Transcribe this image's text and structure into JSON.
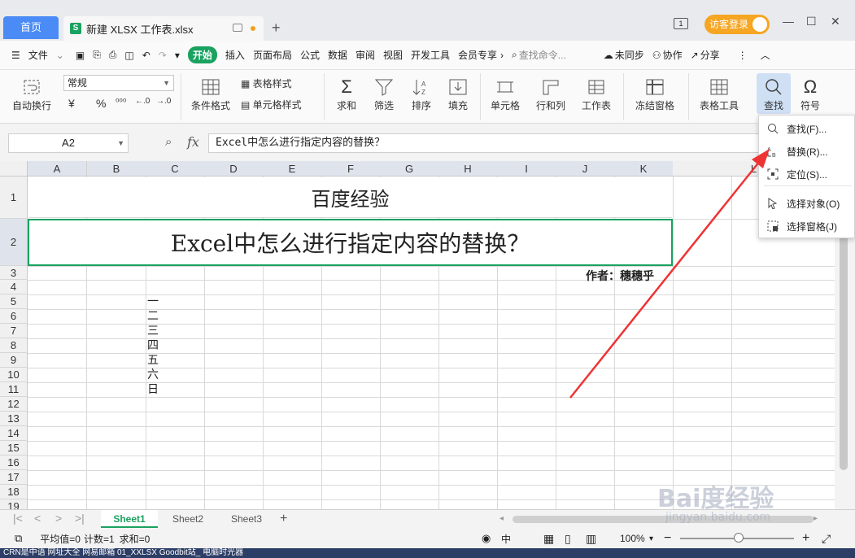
{
  "tabs": {
    "home": "首页",
    "file": "新建 XLSX 工作表.xlsx",
    "file_icon": "S",
    "add": "+"
  },
  "window": {
    "badge": "1",
    "login": "访客登录",
    "minimize": "—",
    "maximize": "☐",
    "close": "✕"
  },
  "menu": {
    "file": "文件",
    "items": [
      "开始",
      "插入",
      "页面布局",
      "公式",
      "数据",
      "审阅",
      "视图",
      "开发工具",
      "会员专享"
    ],
    "search_placeholder": "查找命令...",
    "sync": "未同步",
    "collab": "协作",
    "share": "分享"
  },
  "ribbon": {
    "wrap": "自动换行",
    "number_format": "常规",
    "symbols": [
      "¥",
      "%",
      "⁰⁰⁰",
      "←.0",
      "→.0"
    ],
    "table_style": "表格样式",
    "cond_format": "条件格式",
    "cell_style": "单元格样式",
    "sum": "求和",
    "filter": "筛选",
    "sort": "排序",
    "fill": "填充",
    "cell": "单元格",
    "rowcol": "行和列",
    "worksheet": "工作表",
    "freeze": "冻结窗格",
    "table_tools": "表格工具",
    "find": "查找",
    "symbol": "符号"
  },
  "formula_bar": {
    "cell_ref": "A2",
    "fx": "fx",
    "content": "Excel中怎么进行指定内容的替换？"
  },
  "columns": [
    "A",
    "B",
    "C",
    "D",
    "E",
    "F",
    "G",
    "H",
    "I",
    "J",
    "K",
    "L"
  ],
  "rows": [
    "1",
    "2",
    "3",
    "4",
    "5",
    "6",
    "7",
    "8",
    "9",
    "10",
    "11",
    "12",
    "13",
    "14",
    "15",
    "16",
    "17",
    "18",
    "19"
  ],
  "cells": {
    "title": "百度经验",
    "question": "Excel中怎么进行指定内容的替换？",
    "author": "作者：穗穗乎",
    "c_values": [
      "一",
      "二",
      "三",
      "四",
      "五",
      "六",
      "日"
    ]
  },
  "sheets": [
    "Sheet1",
    "Sheet2",
    "Sheet3"
  ],
  "status": {
    "avg": "平均值=0",
    "count": "计数=1",
    "sum": "求和=0",
    "zoom": "100%",
    "input_mode": "中"
  },
  "find_menu": [
    {
      "label": "查找(F)...",
      "icon": "search-icon"
    },
    {
      "label": "替换(R)...",
      "icon": "replace-icon"
    },
    {
      "label": "定位(S)...",
      "icon": "locate-icon"
    },
    {
      "label": "选择对象(O)",
      "icon": "pointer-icon"
    },
    {
      "label": "选择窗格(J)",
      "icon": "select-pane-icon"
    }
  ],
  "taskbar": "CRN是中语   网址大全   网易邮箱   01_XXLSX  Goodbit站_ 电脑时光器",
  "watermark": {
    "main": "Bai度经验",
    "sub": "jingyan.baidu.com"
  },
  "colors": {
    "accent": "#1aa260",
    "home_tab": "#4a8bf5",
    "login": "#f5a623",
    "arrow": "#ee3333"
  }
}
